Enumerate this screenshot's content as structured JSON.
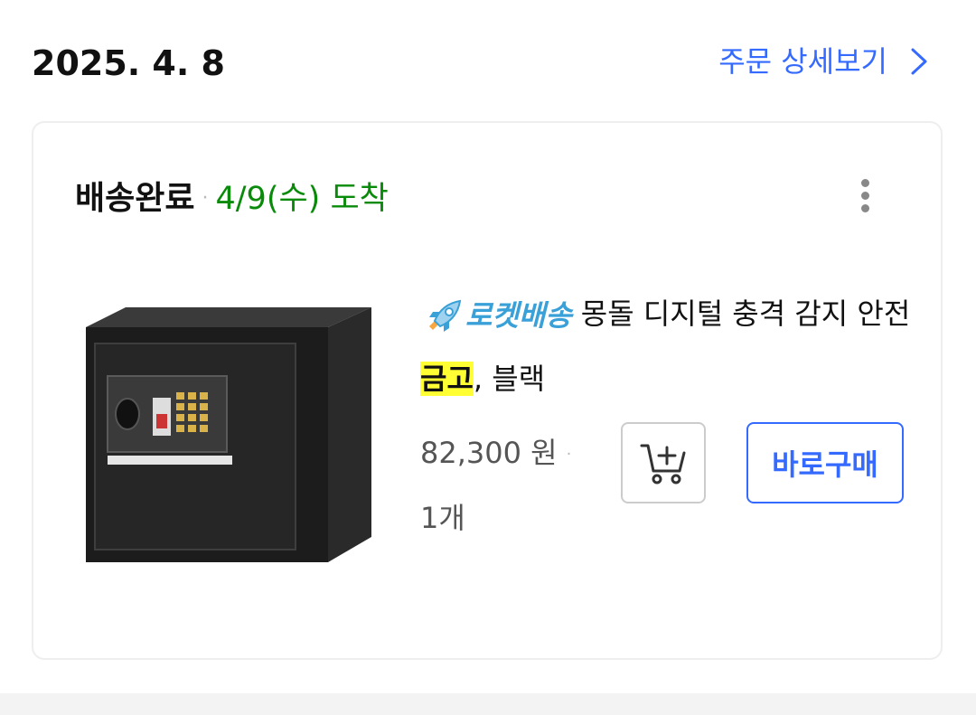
{
  "order": {
    "date": "2025. 4. 8",
    "detail_link_label": "주문 상세보기"
  },
  "delivery": {
    "status": "배송완료",
    "separator": "·",
    "arrival": "4/9(수) 도착"
  },
  "product": {
    "badge_label": "로켓배송",
    "title_part1": "몽돌 디지털 충격 감지 안전 ",
    "title_highlight": "금고",
    "title_part2": ", 블랙",
    "price": "82,300 원",
    "price_separator": "·",
    "quantity": "1개"
  },
  "actions": {
    "buy_now_label": "바로구매"
  },
  "icons": {
    "detail_link": "chevron-right-icon",
    "more": "kebab-menu-icon",
    "badge": "rocket-icon",
    "cart": "add-to-cart-icon"
  },
  "colors": {
    "accent": "#346aff",
    "delivered_green": "#0a8a0a",
    "rocket_blue": "#3aa0d8",
    "highlight": "#ffff33"
  }
}
